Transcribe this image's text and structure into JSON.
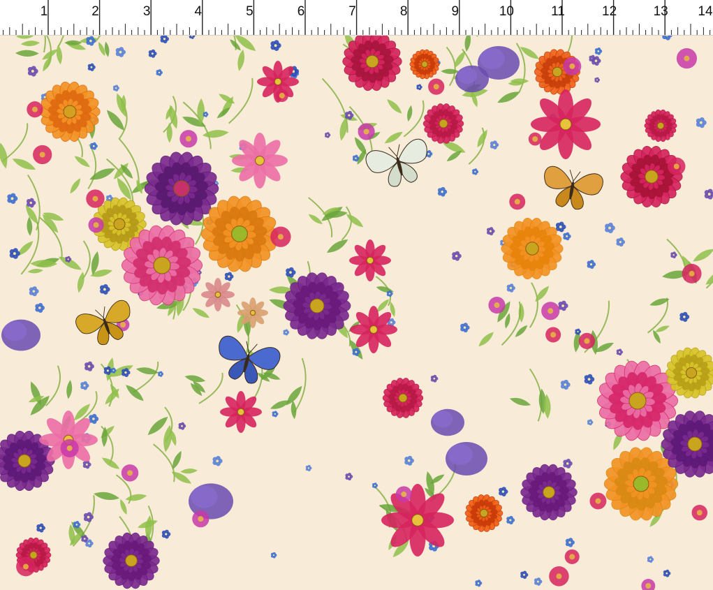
{
  "ruler": {
    "unit_labels": [
      "1",
      "2",
      "3",
      "4",
      "5",
      "6",
      "7",
      "8",
      "9",
      "10",
      "11",
      "12",
      "13",
      "14"
    ]
  },
  "print": {
    "background_color": "#f8ecd8",
    "motifs": [
      "zinnia",
      "cosmos",
      "dahlia",
      "forget-me-not",
      "butterfly",
      "fern-leaf"
    ],
    "palette": {
      "magenta": "#d6245e",
      "pink": "#ec6ea6",
      "orange": "#f39324",
      "yellow": "#d8c42a",
      "purple": "#7b2a8f",
      "violet": "#6a4bb0",
      "blue": "#2c4fb8",
      "green": "#6aa63a",
      "leaf": "#8fbf4a"
    }
  }
}
